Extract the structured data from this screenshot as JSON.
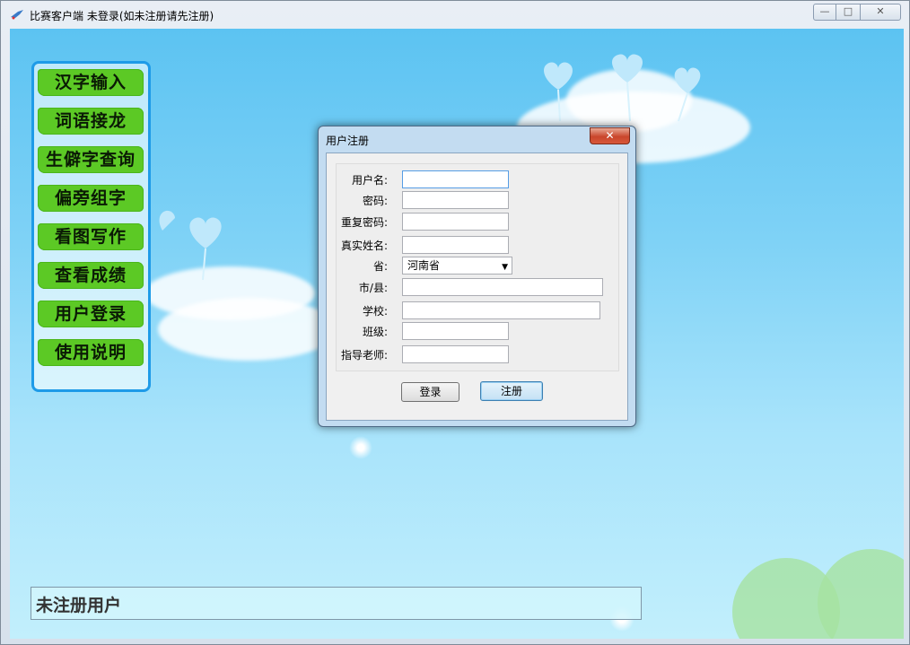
{
  "window": {
    "title": "比赛客户端 未登录(如未注册请先注册)",
    "controls": {
      "minimize": "—",
      "maximize": "□",
      "close": "✕"
    }
  },
  "menu": {
    "items": [
      "汉字输入",
      "词语接龙",
      "生僻字查询",
      "偏旁组字",
      "看图写作",
      "查看成绩",
      "用户登录",
      "使用说明"
    ],
    "button_color": "#5cc925"
  },
  "status": {
    "text": "未注册用户"
  },
  "dialog": {
    "title": "用户注册",
    "close": "✕",
    "fields": {
      "username": {
        "label": "用户名:",
        "value": ""
      },
      "password": {
        "label": "密码:",
        "value": ""
      },
      "repeat_password": {
        "label": "重复密码:",
        "value": ""
      },
      "real_name": {
        "label": "真实姓名:",
        "value": ""
      },
      "province": {
        "label": "省:",
        "value": "河南省"
      },
      "city": {
        "label": "市/县:",
        "value": ""
      },
      "school": {
        "label": "学校:",
        "value": ""
      },
      "class": {
        "label": "班级:",
        "value": ""
      },
      "teacher": {
        "label": "指导老师:",
        "value": ""
      }
    },
    "buttons": {
      "login": "登录",
      "register": "注册"
    }
  }
}
